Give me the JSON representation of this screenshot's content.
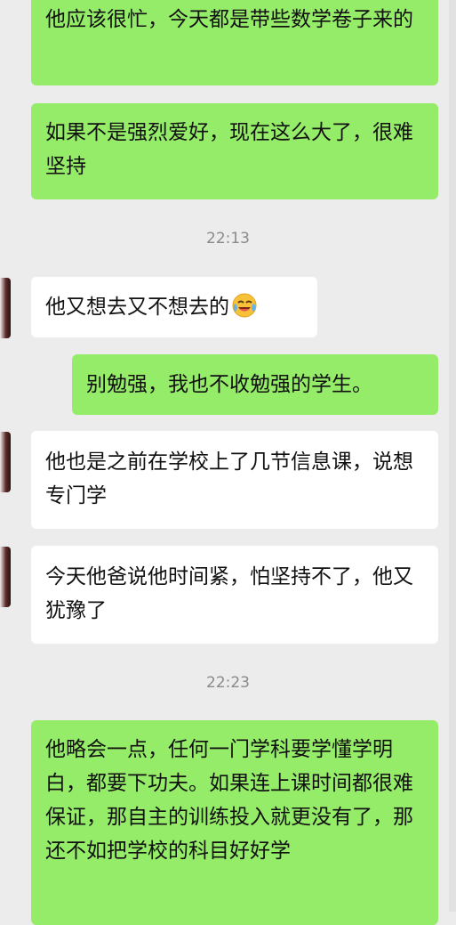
{
  "messages": [
    {
      "side": "out",
      "text": "他应该很忙，今天都是带些数学卷子来的"
    },
    {
      "side": "out",
      "text": "如果不是强烈爱好，现在这么大了，很难坚持"
    },
    {
      "side": "in",
      "text": "他又想去又不想去的",
      "emoji": "crying-laughing-emoji"
    },
    {
      "side": "out",
      "text": "别勉强，我也不收勉强的学生。"
    },
    {
      "side": "in",
      "text": "他也是之前在学校上了几节信息课，说想专门学"
    },
    {
      "side": "in",
      "text": "今天他爸说他时间紧，怕坚持不了，他又犹豫了"
    },
    {
      "side": "out",
      "text": "他略会一点，任何一门学科要学懂学明白，都要下功夫。如果连上课时间都很难保证，那自主的训练投入就更没有了，那还不如把学校的科目好好学"
    }
  ],
  "timestamps": [
    "22:13",
    "22:23"
  ],
  "colors": {
    "outgoing_bubble": "#95ec69",
    "incoming_bubble": "#ffffff",
    "background": "#ececec",
    "timestamp_text": "#8a8a8a"
  }
}
